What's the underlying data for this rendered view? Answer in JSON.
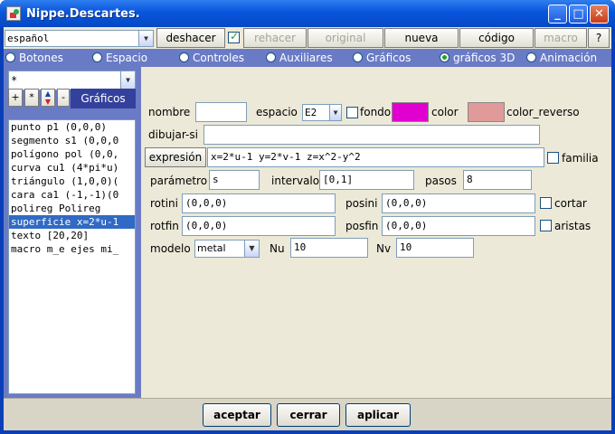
{
  "window": {
    "title": "Nippe.Descartes."
  },
  "toolbar": {
    "language_value": "español",
    "undo_label": "deshacer",
    "undo_checked": true,
    "redo_label": "rehacer",
    "original_label": "original",
    "new_label": "nueva",
    "code_label": "código",
    "macro_label": "macro",
    "help_label": "?"
  },
  "tabs": [
    {
      "label": "Botones",
      "selected": false
    },
    {
      "label": "Espacio",
      "selected": false
    },
    {
      "label": "Controles",
      "selected": false
    },
    {
      "label": "Auxiliares",
      "selected": false
    },
    {
      "label": "Gráficos",
      "selected": false
    },
    {
      "label": "gráficos 3D",
      "selected": true
    },
    {
      "label": "Animación",
      "selected": false
    }
  ],
  "left": {
    "filter_value": "*",
    "add_label": "+",
    "star_label": "*",
    "minus_label": "-",
    "panel_tab_label": "Gráficos",
    "items": [
      "punto p1 (0,0,0)",
      "segmento s1 (0,0,0",
      "polígono pol (0,0,",
      "curva cu1 (4*pi*u)",
      "triángulo (1,0,0)(",
      "cara ca1 (-1,-1)(0",
      "polireg Polireg",
      "superficie x=2*u-1",
      "texto [20,20]",
      "macro m_e ejes mi_"
    ],
    "selected_index": 7
  },
  "form": {
    "nombre_label": "nombre",
    "nombre_value": "",
    "espacio_label": "espacio",
    "espacio_value": "E2",
    "fondo_label": "fondo",
    "fondo_checked": false,
    "color_label": "color",
    "color_value": "#e000d0",
    "color_reverso_label": "color_reverso",
    "color_reverso_value": "#e09a9a",
    "dibujar_si_label": "dibujar-si",
    "dibujar_si_value": "",
    "expresion_label": "expresión",
    "expresion_value": "x=2*u-1 y=2*v-1 z=x^2-y^2",
    "familia_label": "familia",
    "familia_checked": false,
    "parametro_label": "parámetro",
    "parametro_value": "s",
    "intervalo_label": "intervalo",
    "intervalo_value": "[0,1]",
    "pasos_label": "pasos",
    "pasos_value": "8",
    "rotini_label": "rotini",
    "rotini_value": "(0,0,0)",
    "posini_label": "posini",
    "posini_value": "(0,0,0)",
    "cortar_label": "cortar",
    "cortar_checked": false,
    "rotfin_label": "rotfin",
    "rotfin_value": "(0,0,0)",
    "posfin_label": "posfin",
    "posfin_value": "(0,0,0)",
    "aristas_label": "aristas",
    "aristas_checked": false,
    "modelo_label": "modelo",
    "modelo_value": "metal",
    "nu_label": "Nu",
    "nu_value": "10",
    "nv_label": "Nv",
    "nv_value": "10"
  },
  "bottom": {
    "accept_label": "aceptar",
    "close_label": "cerrar",
    "apply_label": "aplicar"
  },
  "icons": {
    "window": "app-icon",
    "minimize": "minimize-icon",
    "maximize": "maximize-icon",
    "close": "close-icon",
    "dropdown": "chevron-down-icon",
    "move": "up-down-arrows-icon"
  }
}
